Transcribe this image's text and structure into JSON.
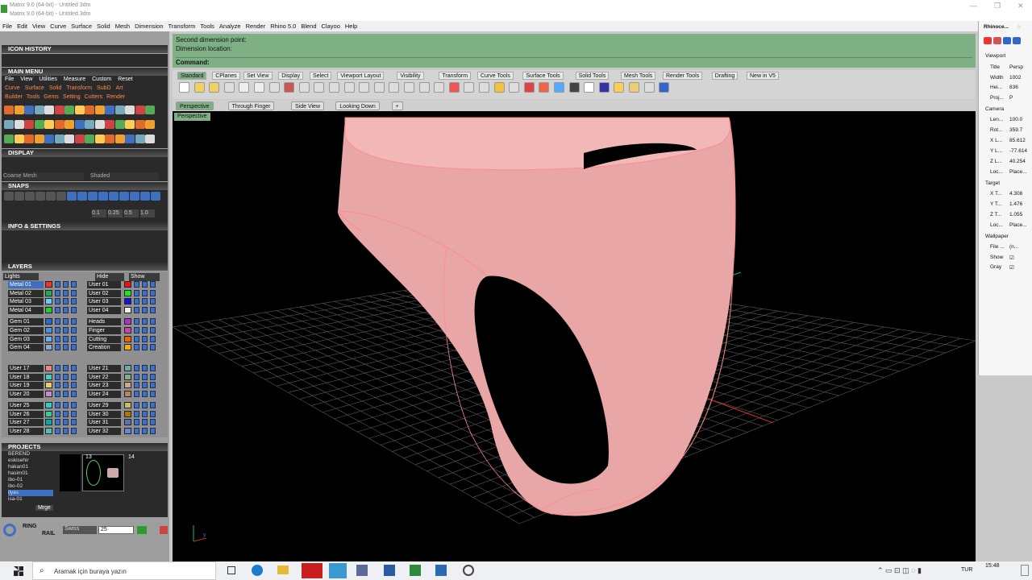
{
  "window": {
    "title": "Matrix 9.0 (64-bit) - Untitled 3dm",
    "subtitle": "Matrix 9.0 (64-bit) - Untitled.3dm"
  },
  "menu": [
    "File",
    "Edit",
    "View",
    "Curve",
    "Surface",
    "Solid",
    "Mesh",
    "Dimension",
    "Transform",
    "Tools",
    "Analyze",
    "Render",
    "Rhino 5.0",
    "Blend",
    "Clayoo",
    "Help"
  ],
  "left": {
    "icon_history": "ICON HISTORY",
    "main_menu": "MAIN MENU",
    "main_menu_items": [
      "File",
      "View",
      "Utilities",
      "Measure",
      "Custom",
      "Reset"
    ],
    "main_menu_row2": [
      "Curve",
      "Surface",
      "Solid",
      "Transform",
      "SubD",
      "Art"
    ],
    "main_menu_row3": [
      "Builder",
      "Tools",
      "Gems",
      "Setting",
      "Cutters",
      "Render"
    ],
    "display": "DISPLAY",
    "display_mesh": "Coarse Mesh",
    "display_mode": "Shaded",
    "snaps": "SNAPS",
    "snap_vals": [
      "0.1",
      "0.25",
      "0.5",
      "1.0"
    ],
    "info": "INFO & SETTINGS",
    "layers": "LAYERS",
    "layers_lights": "Lights",
    "layers_hide": "Hide",
    "layers_show": "Show",
    "layers_left": [
      "Metal 01",
      "Metal 02",
      "Metal 03",
      "Metal 04",
      "Gem 01",
      "Gem 02",
      "Gem 03",
      "Gem 04",
      "User 17",
      "User 18",
      "User 19",
      "User 20",
      "User 25",
      "User 26",
      "User 27",
      "User 28"
    ],
    "layers_right": [
      "User 01",
      "User 02",
      "User 03",
      "User 04",
      "Heads",
      "Finger",
      "Cutting",
      "Creation",
      "User 21",
      "User 22",
      "User 23",
      "User 24",
      "User 29",
      "User 30",
      "User 31",
      "User 32"
    ],
    "projects": "PROJECTS",
    "project_list": [
      "BEREND",
      "eskisehir",
      "hakan01",
      "hasim01",
      "ibo-01",
      "ibo-02",
      "ilyas",
      "isa-01"
    ],
    "project_thumb_nums": [
      "13",
      "14"
    ],
    "merge": "Mrge",
    "ring_rail": "RING\nRAIL",
    "ring_label_1": "RING",
    "ring_label_2": "RAIL",
    "ring_style": "Swiss",
    "ring_size": "25"
  },
  "command": {
    "line1": "Second dimension point:",
    "line2": "Dimension location:",
    "prompt": "Command:"
  },
  "toolbar_tabs": [
    "Standard",
    "CPlanes",
    "Set View",
    "Display",
    "Select",
    "Viewport Layout",
    "Visibility",
    "Transform",
    "Curve Tools",
    "Surface Tools",
    "Solid Tools",
    "Mesh Tools",
    "Render Tools",
    "Drafting",
    "New in V5"
  ],
  "viewport_tabs": [
    "Perspective",
    "Through Finger",
    "Side View",
    "Looking Down"
  ],
  "viewport_label": "Perspective",
  "right_panel": {
    "title": "Rhinoce...",
    "viewport": "Viewport",
    "fields": [
      [
        "Title",
        "Persp"
      ],
      [
        "Width",
        "1002"
      ],
      [
        "Hei...",
        "836"
      ],
      [
        "Proj...",
        "P"
      ]
    ],
    "camera": "Camera",
    "camera_fields": [
      [
        "Len...",
        "100.0"
      ],
      [
        "Rot...",
        "359.7"
      ],
      [
        "X L...",
        "85.612"
      ],
      [
        "Y L...",
        "-77.614"
      ],
      [
        "Z L...",
        "40.254"
      ],
      [
        "Loc...",
        "Place..."
      ]
    ],
    "target": "Target",
    "target_fields": [
      [
        "X T...",
        "4.308"
      ],
      [
        "Y T...",
        "1.476"
      ],
      [
        "Z T...",
        "1.055"
      ],
      [
        "Loc...",
        "Place..."
      ]
    ],
    "wallpaper": "Wallpaper",
    "wall_fields": [
      [
        "File ...",
        "(n..."
      ],
      [
        "Show",
        "☑"
      ],
      [
        "Gray",
        "☑"
      ]
    ]
  },
  "taskbar": {
    "search": "Aramak için buraya yazın",
    "lang": "TUR",
    "time": "15:48"
  },
  "colors": {
    "ring": "#e8a0a0",
    "cmd": "#7fb085",
    "grid": "#5a5a5a"
  }
}
